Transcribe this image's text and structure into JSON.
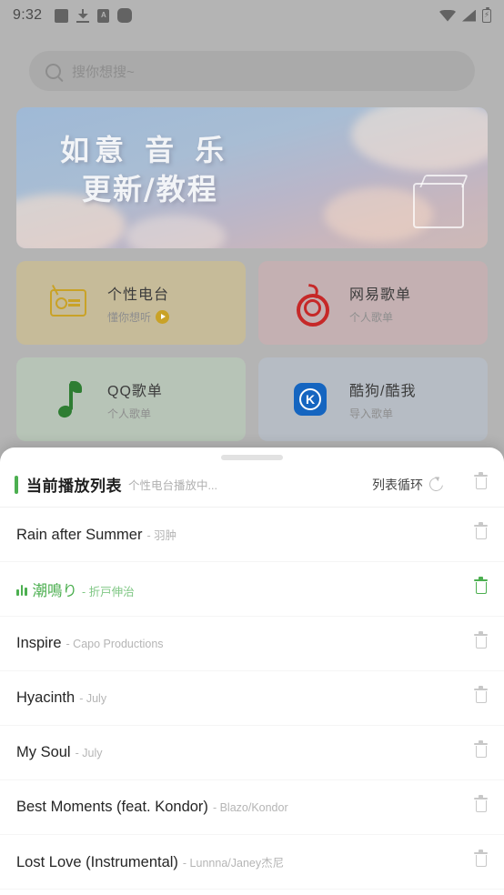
{
  "status_bar": {
    "clock": "9:32",
    "left_icons": [
      "app-square-icon",
      "download-icon",
      "text-badge-icon",
      "rounded-square-icon"
    ],
    "right_icons": [
      "wifi-icon",
      "signal-icon",
      "battery-charging-icon"
    ]
  },
  "search": {
    "placeholder": "搜你想搜~",
    "icon": "search-icon"
  },
  "banner": {
    "line1": "如意 音 乐",
    "line2": "更新/教程"
  },
  "cards": [
    {
      "title": "个性电台",
      "subtitle": "懂你想听",
      "icon": "radio-icon",
      "has_play_badge": true,
      "bg": "#c6bb99",
      "accent": "#c9a227"
    },
    {
      "title": "网易歌单",
      "subtitle": "个人歌单",
      "icon": "netease-icon",
      "has_play_badge": false,
      "bg": "#c4b0b2",
      "accent": "#c62828"
    },
    {
      "title": "QQ歌单",
      "subtitle": "个人歌单",
      "icon": "qq-note-icon",
      "has_play_badge": false,
      "bg": "#b7c4b7",
      "accent": "#2e7d32"
    },
    {
      "title": "酷狗/酷我",
      "subtitle": "导入歌单",
      "icon": "kugou-icon",
      "has_play_badge": false,
      "bg": "#b6bcc4",
      "accent": "#1565c0",
      "logo_letter": "K"
    }
  ],
  "sheet": {
    "title": "当前播放列表",
    "subtitle": "个性电台播放中...",
    "loop_label": "列表循环",
    "loop_icon": "loop-arrow-icon",
    "clear_icon": "trash-icon",
    "accent_color": "#4caf50",
    "rows": [
      {
        "title": "Rain after Summer",
        "artist": "- 羽肿",
        "playing": false
      },
      {
        "title": "潮鳴り",
        "artist": "- 折戸伸治",
        "playing": true
      },
      {
        "title": "Inspire",
        "artist": "- Capo Productions",
        "playing": false
      },
      {
        "title": "Hyacinth",
        "artist": "- July",
        "playing": false
      },
      {
        "title": "My Soul",
        "artist": "- July",
        "playing": false
      },
      {
        "title": "Best Moments (feat. Kondor)",
        "artist": "- Blazo/Kondor",
        "playing": false
      },
      {
        "title": "Lost Love (Instrumental)",
        "artist": "- Lunnna/Janey杰尼",
        "playing": false
      }
    ]
  }
}
